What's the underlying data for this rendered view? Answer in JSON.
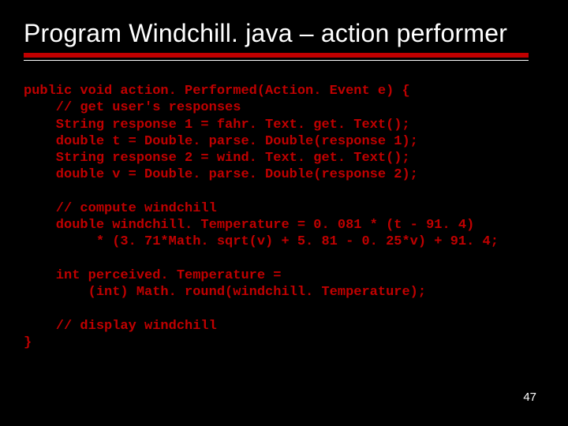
{
  "title": "Program Windchill. java – action performer",
  "code_lines": [
    "public void action. Performed(Action. Event e) {",
    "    // get user's responses",
    "    String response 1 = fahr. Text. get. Text();",
    "    double t = Double. parse. Double(response 1);",
    "    String response 2 = wind. Text. get. Text();",
    "    double v = Double. parse. Double(response 2);",
    "",
    "    // compute windchill",
    "    double windchill. Temperature = 0. 081 * (t - 91. 4)",
    "         * (3. 71*Math. sqrt(v) + 5. 81 - 0. 25*v) + 91. 4;",
    "",
    "    int perceived. Temperature =",
    "        (int) Math. round(windchill. Temperature);",
    "",
    "    // display windchill",
    "}"
  ],
  "page_number": "47",
  "colors": {
    "accent": "#c00000",
    "bg": "#000000",
    "fg": "#ffffff"
  }
}
